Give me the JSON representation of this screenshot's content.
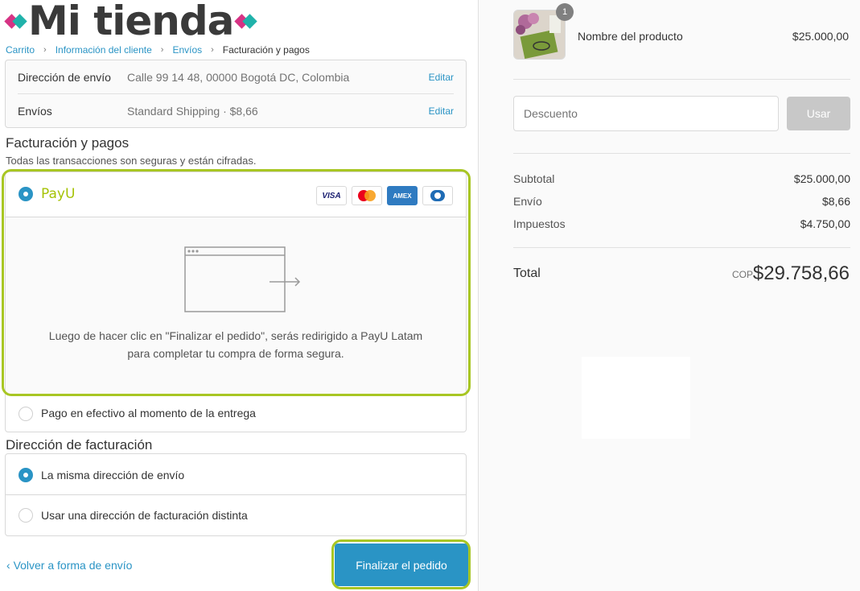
{
  "brand": {
    "logo_text": "Mi tienda",
    "accent_pink": "#d63384",
    "accent_teal": "#20b2aa",
    "accent_blue": "#2a94c5",
    "highlight_green": "#a8c623"
  },
  "breadcrumb": {
    "items": [
      "Carrito",
      "Información del cliente",
      "Envíos"
    ],
    "current": "Facturación y pagos",
    "separator_icon": "chevron-right-icon"
  },
  "review": {
    "shipping_address": {
      "label": "Dirección de envío",
      "value": "Calle 99 14 48, 00000 Bogotá DC, Colombia",
      "edit": "Editar"
    },
    "shipping_method": {
      "label": "Envíos",
      "value": "Standard Shipping · $8,66",
      "edit": "Editar"
    }
  },
  "payment": {
    "title": "Facturación y pagos",
    "subtitle": "Todas las transacciones son seguras y están cifradas.",
    "payu": {
      "logo": "PayU",
      "selected": true,
      "cards": [
        "VISA",
        "mastercard-icon",
        "AMEX",
        "diners-icon"
      ]
    },
    "redirect_icon": "browser-redirect-icon",
    "redirect_text": "Luego de hacer clic en \"Finalizar el pedido\", serás redirigido a PayU Latam para completar tu compra de forma segura.",
    "cash_option": {
      "label": "Pago en efectivo al momento de la entrega",
      "selected": false
    }
  },
  "billing": {
    "title": "Dirección de facturación",
    "options": [
      {
        "label": "La misma dirección de envío",
        "selected": true
      },
      {
        "label": "Usar una dirección de facturación distinta",
        "selected": false
      }
    ]
  },
  "actions": {
    "back_icon": "chevron-left-icon",
    "back": "Volver a forma de envío",
    "finish": "Finalizar el pedido"
  },
  "summary": {
    "product": {
      "quantity": "1",
      "name": "Nombre del producto",
      "price": "$25.000,00",
      "image": "product-thumbnail"
    },
    "discount": {
      "placeholder": "Descuento",
      "button": "Usar"
    },
    "lines": [
      {
        "label": "Subtotal",
        "value": "$25.000,00"
      },
      {
        "label": "Envío",
        "value": "$8,66"
      },
      {
        "label": "Impuestos",
        "value": "$4.750,00"
      }
    ],
    "total": {
      "label": "Total",
      "currency": "COP",
      "value": "$29.758,66"
    }
  }
}
